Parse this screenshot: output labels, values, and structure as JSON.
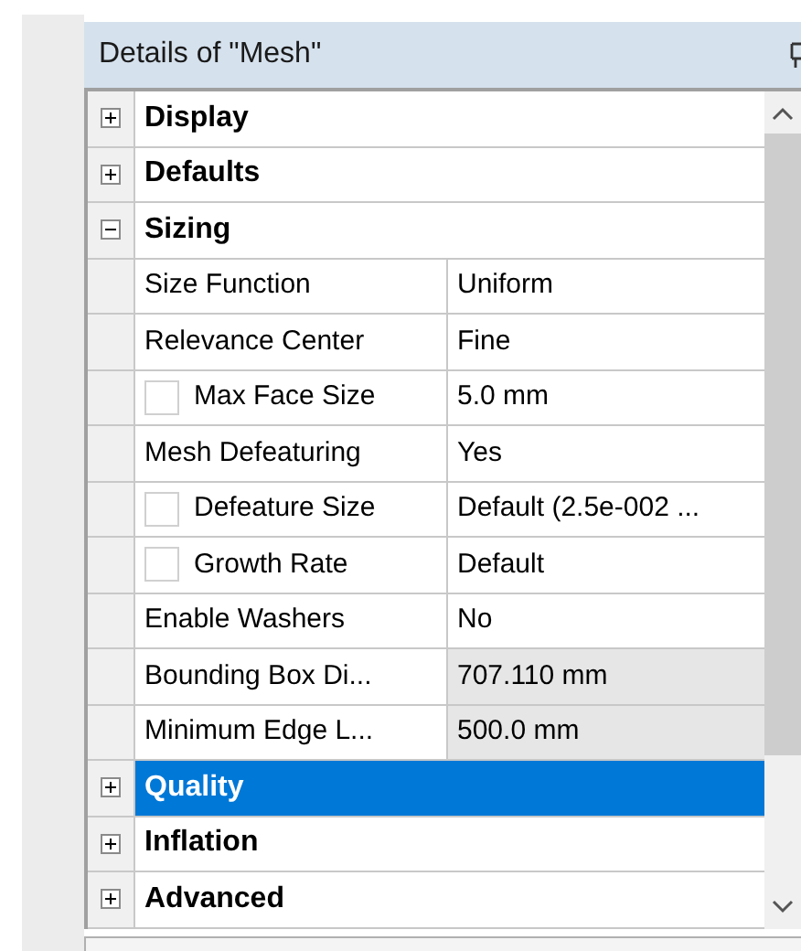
{
  "panel": {
    "title": "Details of \"Mesh\""
  },
  "sections": [
    {
      "label": "Display",
      "expanded": false,
      "selected": false
    },
    {
      "label": "Defaults",
      "expanded": false,
      "selected": false
    },
    {
      "label": "Sizing",
      "expanded": true,
      "selected": false,
      "children": [
        {
          "kind": "plain",
          "label": "Size Function",
          "value": "Uniform",
          "readonly": false
        },
        {
          "kind": "plain",
          "label": "Relevance Center",
          "value": "Fine",
          "readonly": false
        },
        {
          "kind": "checkbox",
          "label": "Max Face Size",
          "value": "5.0 mm",
          "checked": false,
          "readonly": false
        },
        {
          "kind": "plain",
          "label": "Mesh Defeaturing",
          "value": "Yes",
          "readonly": false
        },
        {
          "kind": "checkbox",
          "label": "Defeature Size",
          "value": "Default (2.5e-002 ...",
          "checked": false,
          "readonly": false
        },
        {
          "kind": "checkbox",
          "label": "Growth Rate",
          "value": "Default",
          "checked": false,
          "readonly": false
        },
        {
          "kind": "plain",
          "label": "Enable Washers",
          "value": "No",
          "readonly": false
        },
        {
          "kind": "plain",
          "label": "Bounding Box Di...",
          "value": "707.110 mm",
          "readonly": true
        },
        {
          "kind": "plain",
          "label": "Minimum Edge L...",
          "value": "500.0 mm",
          "readonly": true
        }
      ]
    },
    {
      "label": "Quality",
      "expanded": false,
      "selected": true
    },
    {
      "label": "Inflation",
      "expanded": false,
      "selected": false
    },
    {
      "label": "Advanced",
      "expanded": false,
      "selected": false
    }
  ]
}
